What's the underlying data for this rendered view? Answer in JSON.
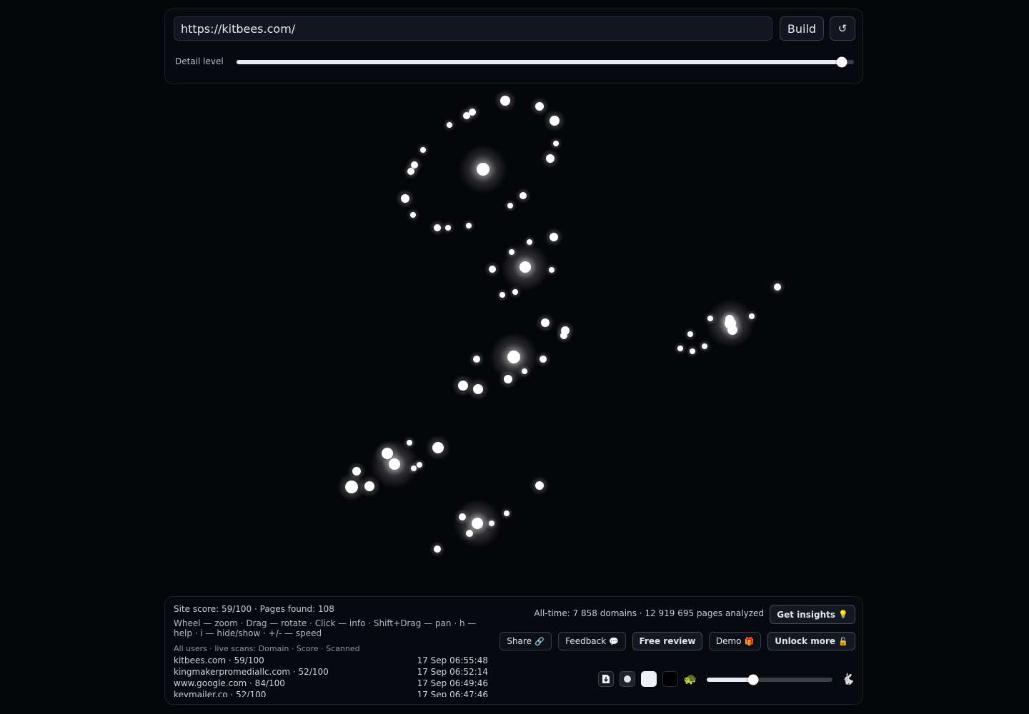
{
  "top": {
    "url_value": "https://kitbees.com/",
    "build_label": "Build",
    "reset_glyph": "↺",
    "detail_label": "Detail level",
    "detail_level": 0.98
  },
  "stats": {
    "site_line": "Site score: 59/100 · Pages found: 108",
    "help_text": "Wheel — zoom · Drag — rotate · Click — info · Shift+Drag — pan · h — help · i — hide/show · +/- — speed",
    "scans_label": "All users · live scans: Domain · Score · Scanned",
    "scans": [
      {
        "domain": "kitbees.com · 59/100",
        "time": "17 Sep 06:55:48"
      },
      {
        "domain": "kingmakerpromediallc.com · 52/100",
        "time": "17 Sep 06:52:14"
      },
      {
        "domain": "www.google.com · 84/100",
        "time": "17 Sep 06:49:46"
      },
      {
        "domain": "keymailer.co · 52/100",
        "time": "17 Sep 06:47:46"
      }
    ],
    "alltime": "All-time: 7 858 domains · 12 919 695 pages analyzed"
  },
  "actions": {
    "get_insights": "Get insights",
    "get_insights_icon": "💡",
    "share": "Share",
    "share_icon": "🔗",
    "feedback": "Feedback",
    "feedback_icon": "💬",
    "free_review": "Free review",
    "demo": "Demo",
    "demo_icon": "🎁",
    "unlock": "Unlock more",
    "unlock_icon": "🔓"
  },
  "tools": {
    "export_icon": "download-icon",
    "dot_style_icon": "dot-style-icon",
    "light_bg_icon": "light-background-icon",
    "dark_bg_icon": "dark-background-icon",
    "slow_emoji": "🐢",
    "fast_emoji": "🐇",
    "speed_level": 0.37
  },
  "colors": {
    "background": "#05060a",
    "node": "#ffffff"
  }
}
